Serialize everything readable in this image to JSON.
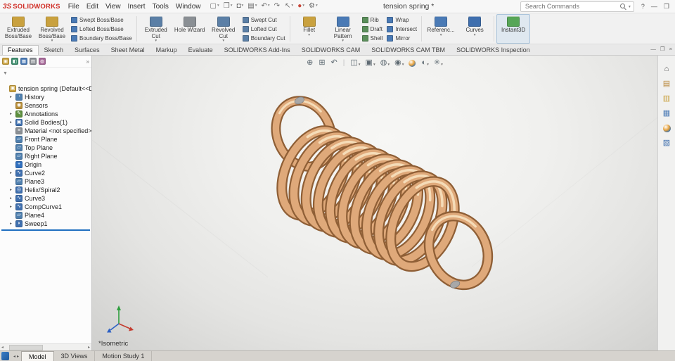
{
  "titlebar": {
    "logo_mark": "3S",
    "logo_text": "SOLIDWORKS",
    "menus": [
      "File",
      "Edit",
      "View",
      "Insert",
      "Tools",
      "Window"
    ],
    "toolbar": [
      {
        "name": "new-document-button",
        "glyph": "▢",
        "caret": "▾"
      },
      {
        "name": "open-document-button",
        "glyph": "❒",
        "caret": "▾"
      },
      {
        "name": "save-button",
        "glyph": "◘",
        "caret": "▾"
      },
      {
        "name": "print-button",
        "glyph": "▤",
        "caret": "▾"
      },
      {
        "name": "undo-button",
        "glyph": "↶",
        "caret": "▾"
      },
      {
        "name": "redo-button",
        "glyph": "↷",
        "caret": ""
      },
      {
        "name": "select-button",
        "glyph": "↖",
        "caret": "▾"
      },
      {
        "name": "rebuild-button",
        "glyph": "●",
        "caret": "▾",
        "color": "#c8473a"
      },
      {
        "name": "options-button",
        "glyph": "⚙",
        "caret": "▾"
      }
    ],
    "document_title": "tension spring *",
    "search": {
      "placeholder": "Search Commands",
      "caret": "▾"
    },
    "window_buttons": [
      {
        "name": "help-button",
        "glyph": "?"
      },
      {
        "name": "minimize-button",
        "glyph": "—"
      },
      {
        "name": "restore-button",
        "glyph": "❐"
      }
    ]
  },
  "ribbon": {
    "large": [
      {
        "label": "Extruded Boss/Base",
        "color": "#c9a13f",
        "caret": ""
      },
      {
        "label": "Revolved Boss/Base",
        "color": "#c9a13f",
        "caret": "▾"
      },
      {
        "label": "Extruded Cut",
        "color": "#5b7fa6",
        "caret": "▾"
      },
      {
        "label": "Hole Wizard",
        "color": "#8a8f94",
        "caret": ""
      },
      {
        "label": "Revolved Cut",
        "color": "#5b7fa6",
        "caret": "▾"
      },
      {
        "label": "Fillet",
        "color": "#c9a13f",
        "caret": "▾"
      },
      {
        "label": "Linear Pattern",
        "color": "#4a7ab5",
        "caret": "▾"
      },
      {
        "label": "Referenc...",
        "color": "#4a7ab5",
        "caret": "▾"
      },
      {
        "label": "Curves",
        "color": "#3f6fae",
        "caret": "▾"
      },
      {
        "label": "Instant3D",
        "color": "#57a657",
        "caret": "",
        "cls": "active"
      }
    ],
    "stacks": [
      {
        "items": [
          {
            "label": "Swept Boss/Base",
            "color": "#4a7ab5"
          },
          {
            "label": "Lofted Boss/Base",
            "color": "#4a7ab5"
          },
          {
            "label": "Boundary Boss/Base",
            "color": "#4a7ab5"
          }
        ]
      },
      {
        "items": [
          {
            "label": "Swept Cut",
            "color": "#5b7fa6"
          },
          {
            "label": "Lofted Cut",
            "color": "#5b7fa6"
          },
          {
            "label": "Boundary Cut",
            "color": "#5b7fa6"
          }
        ]
      },
      {
        "items": [
          {
            "label": "Rib",
            "color": "#5b8f5b"
          },
          {
            "label": "Draft",
            "color": "#5b8f5b"
          },
          {
            "label": "Shell",
            "color": "#5b8f5b"
          }
        ]
      },
      {
        "items": [
          {
            "label": "Wrap",
            "color": "#4a7ab5"
          },
          {
            "label": "Intersect",
            "color": "#4a7ab5"
          },
          {
            "label": "Mirror",
            "color": "#4a7ab5"
          }
        ]
      }
    ]
  },
  "tabs": {
    "items": [
      {
        "label": "Features",
        "cls": "active"
      },
      {
        "label": "Sketch"
      },
      {
        "label": "Surfaces"
      },
      {
        "label": "Sheet Metal"
      },
      {
        "label": "Markup"
      },
      {
        "label": "Evaluate"
      },
      {
        "label": "SOLIDWORKS Add-Ins"
      },
      {
        "label": "SOLIDWORKS CAM"
      },
      {
        "label": "SOLIDWORKS CAM TBM"
      },
      {
        "label": "SOLIDWORKS Inspection"
      }
    ],
    "window_controls": [
      {
        "name": "document-minimize-icon",
        "glyph": "—"
      },
      {
        "name": "document-restore-icon",
        "glyph": "❐"
      },
      {
        "name": "document-close-icon",
        "glyph": "×"
      }
    ]
  },
  "feature_tree": {
    "pane_tabs": [
      {
        "name": "featuremanager-tab-icon",
        "glyph": "▣",
        "color": "#c9a13f"
      },
      {
        "name": "propertymanager-tab-icon",
        "glyph": "◧",
        "color": "#3f8f6f"
      },
      {
        "name": "configurationmanager-tab-icon",
        "glyph": "▦",
        "color": "#4a7ab5"
      },
      {
        "name": "dimxpertmanager-tab-icon",
        "glyph": "▤",
        "color": "#8a8f94"
      },
      {
        "name": "displaymanager-tab-icon",
        "glyph": "◍",
        "color": "#a86a9a"
      }
    ],
    "pane_tab_chevron": "»",
    "filter_glyph": "▼",
    "scroll_left": "◂",
    "scroll_right": "▸",
    "items": [
      {
        "label": "tension spring (Default<<Default>_D",
        "glyph": "▣",
        "color": "#c9a13f",
        "arrow": "",
        "cls": "root"
      },
      {
        "label": "History",
        "glyph": "◔",
        "color": "#4f7fae",
        "arrow": "▸"
      },
      {
        "label": "Sensors",
        "glyph": "◉",
        "color": "#b98f3a",
        "arrow": ""
      },
      {
        "label": "Annotations",
        "glyph": "✎",
        "color": "#5d8f3e",
        "arrow": "▸"
      },
      {
        "label": "Solid Bodies(1)",
        "glyph": "▣",
        "color": "#3f6fae",
        "arrow": "▸"
      },
      {
        "label": "Material <not specified>",
        "glyph": "≡",
        "color": "#8a8f94",
        "arrow": ""
      },
      {
        "label": "Front Plane",
        "glyph": "▱",
        "color": "#4f7fae",
        "arrow": ""
      },
      {
        "label": "Top Plane",
        "glyph": "▱",
        "color": "#4f7fae",
        "arrow": ""
      },
      {
        "label": "Right Plane",
        "glyph": "▱",
        "color": "#4f7fae",
        "arrow": ""
      },
      {
        "label": "Origin",
        "glyph": "+",
        "color": "#2f6fbe",
        "arrow": ""
      },
      {
        "label": "Curve2",
        "glyph": "∿",
        "color": "#3f6fae",
        "arrow": "▸"
      },
      {
        "label": "Plane3",
        "glyph": "▱",
        "color": "#4f7fae",
        "arrow": ""
      },
      {
        "label": "Helix/Spiral2",
        "glyph": "◎",
        "color": "#3f6fae",
        "arrow": "▸"
      },
      {
        "label": "Curve3",
        "glyph": "∿",
        "color": "#3f6fae",
        "arrow": "▸"
      },
      {
        "label": "CompCurve1",
        "glyph": "∿",
        "color": "#3f6fae",
        "arrow": "▸"
      },
      {
        "label": "Plane4",
        "glyph": "▱",
        "color": "#4f7fae",
        "arrow": ""
      },
      {
        "label": "Sweep1",
        "glyph": "◗",
        "color": "#3f6fae",
        "arrow": "▸"
      }
    ]
  },
  "viewport": {
    "view_label": "*Isometric",
    "headsup": [
      {
        "name": "zoom-fit-icon",
        "glyph": "⊕",
        "caret": ""
      },
      {
        "name": "zoom-area-icon",
        "glyph": "⊞",
        "caret": ""
      },
      {
        "name": "previous-view-icon",
        "glyph": "↶",
        "caret": ""
      },
      {
        "name": "headsup-separator",
        "glyph": "|",
        "caret": "",
        "cls": "sep"
      },
      {
        "name": "section-view-icon",
        "glyph": "◫",
        "caret": "▾"
      },
      {
        "name": "view-orientation-icon",
        "glyph": "▣",
        "caret": "▾"
      },
      {
        "name": "display-style-icon",
        "glyph": "◍",
        "caret": "▾"
      },
      {
        "name": "hide-show-items-icon",
        "glyph": "◉",
        "caret": "▾"
      },
      {
        "name": "edit-appearance-icon",
        "glyph": "",
        "caret": "",
        "cls": "ball"
      },
      {
        "name": "apply-scene-icon",
        "glyph": "◐",
        "caret": "▾"
      },
      {
        "name": "view-settings-icon",
        "glyph": "✳",
        "caret": "▾"
      }
    ],
    "spring_colors": {
      "body": "#dfa97a",
      "outline": "#8f5f36",
      "highlight": "#f5dcb8",
      "wire_end_cap": "#a8a8a8"
    },
    "triad_colors": {
      "x": "#c43b2e",
      "y": "#2e9e3e",
      "z": "#2b5fc4"
    }
  },
  "taskpane": {
    "items": [
      {
        "name": "solidworks-resources-icon",
        "glyph": "⌂",
        "color": "#555555"
      },
      {
        "name": "design-library-icon",
        "glyph": "▤",
        "color": "#b9883a"
      },
      {
        "name": "file-explorer-icon",
        "glyph": "▥",
        "color": "#c9a13f"
      },
      {
        "name": "view-palette-icon",
        "glyph": "▦",
        "color": "#4a7ab5"
      },
      {
        "name": "appearances-scenes-icon",
        "glyph": "",
        "color": "",
        "cls": "ball"
      },
      {
        "name": "custom-properties-icon",
        "glyph": "▧",
        "color": "#3f6fae"
      }
    ]
  },
  "bottombar": {
    "scroll_left": "◂",
    "scroll_right": "▸",
    "tabs": [
      {
        "label": "Model",
        "cls": "active"
      },
      {
        "label": "3D Views"
      },
      {
        "label": "Motion Study 1"
      }
    ]
  }
}
